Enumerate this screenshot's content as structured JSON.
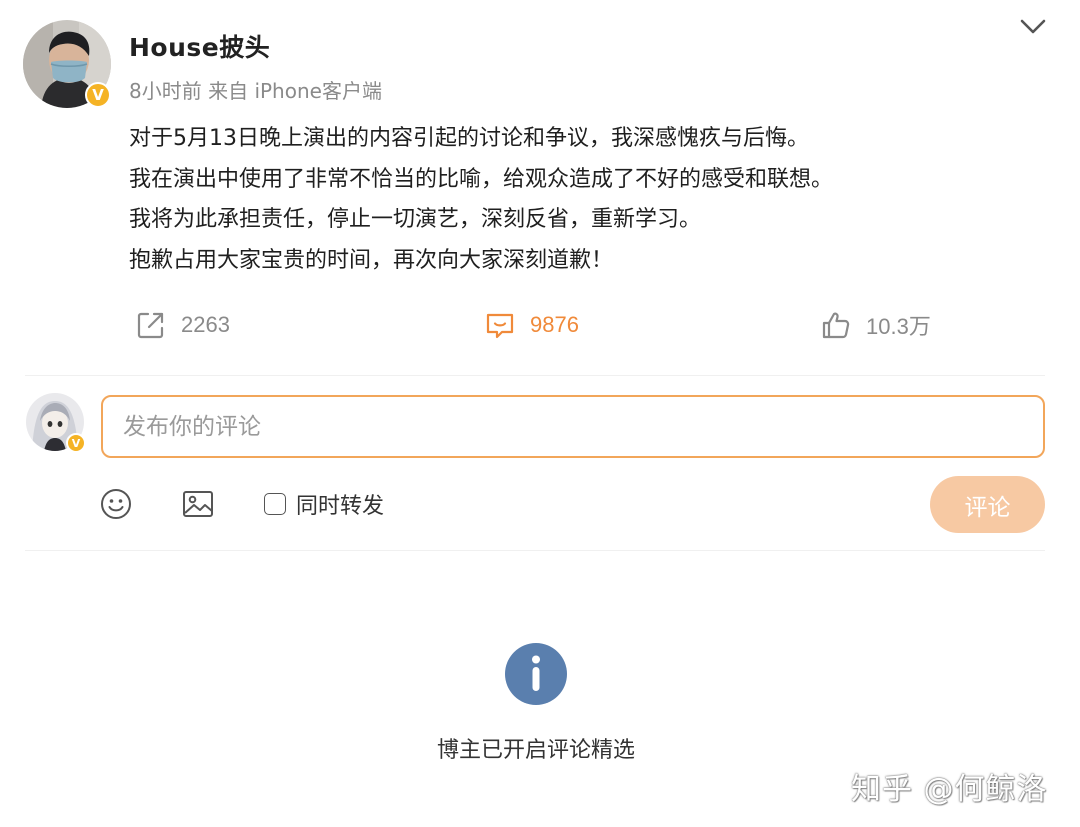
{
  "post": {
    "author": "House披头",
    "verified_badge": "V",
    "meta": "8小时前  来自 iPhone客户端",
    "body_lines": [
      "对于5月13日晚上演出的内容引起的讨论和争议，我深感愧疚与后悔。",
      "我在演出中使用了非常不恰当的比喻，给观众造成了不好的感受和联想。",
      "我将为此承担责任，停止一切演艺，深刻反省，重新学习。",
      "抱歉占用大家宝贵的时间，再次向大家深刻道歉！"
    ],
    "actions": {
      "repost": {
        "icon": "share-icon",
        "count": "2263"
      },
      "comment": {
        "icon": "comment-icon",
        "count": "9876"
      },
      "like": {
        "icon": "thumbs-up-icon",
        "count": "10.3万"
      }
    }
  },
  "composer": {
    "placeholder": "发布你的评论",
    "value": "",
    "repost_label": "同时转发",
    "submit_label": "评论",
    "user_badge": "V"
  },
  "notice": {
    "icon": "info-icon",
    "text": "博主已开启评论精选"
  },
  "watermark": "知乎 @何鲸洛",
  "colors": {
    "accent": "#f08a3a",
    "input_border": "#f2a65a",
    "submit_disabled": "#f7c9a3",
    "badge": "#f5b325",
    "info": "#5a7fae",
    "muted": "#8a8a8a"
  }
}
